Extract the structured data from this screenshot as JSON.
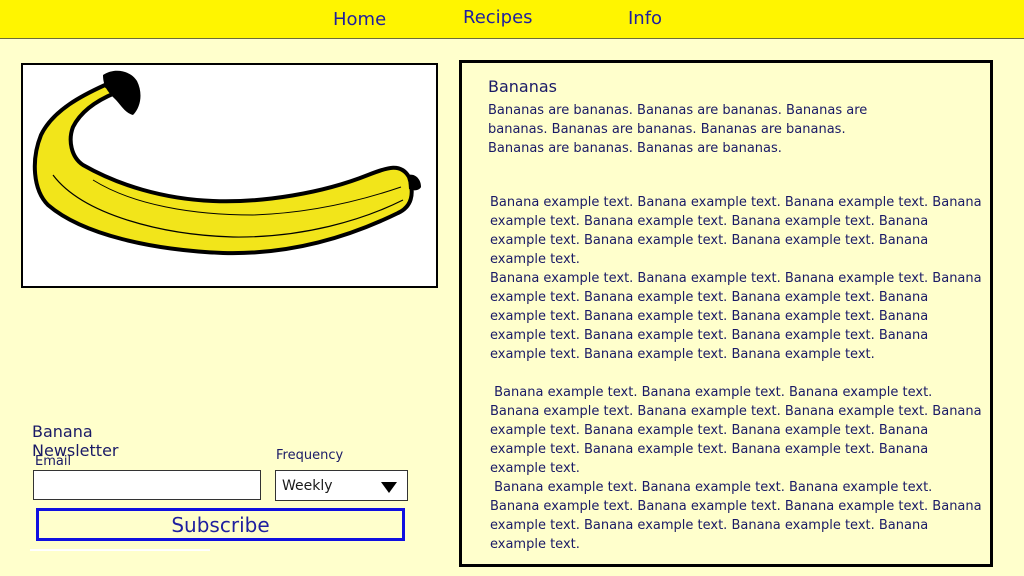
{
  "nav": {
    "items": [
      {
        "label": "Home"
      },
      {
        "label": "Recipes"
      },
      {
        "label": "Info"
      }
    ]
  },
  "hero": {
    "icon": "banana-illustration"
  },
  "article": {
    "title": "Bananas",
    "intro": "Bananas are bananas. Bananas are bananas. Bananas are bananas. Bananas are bananas. Bananas are bananas. Bananas are bananas. Bananas are bananas.",
    "paragraphs": [
      "Banana example text. Banana example text. Banana example text. Banana example text. Banana example text. Banana example text. Banana example text. Banana example text. Banana example text. Banana example text.",
      "Banana example text. Banana example text. Banana example text. Banana example text. Banana example text. Banana example text. Banana example text. Banana example text. Banana example text. Banana example text. Banana example text. Banana example text. Banana example text. Banana example text. Banana example text.",
      " Banana example text. Banana example text. Banana example text. Banana example text. Banana example text. Banana example text. Banana example text. Banana example text. Banana example text. Banana example text. Banana example text. Banana example text. Banana example text.",
      " Banana example text. Banana example text. Banana example text. Banana example text. Banana example text. Banana example text. Banana example text. Banana example text. Banana example text. Banana example text."
    ]
  },
  "newsletter": {
    "title": "Banana Newsletter",
    "email_label": "Email",
    "email_value": "",
    "frequency_label": "Frequency",
    "frequency_value": "Weekly",
    "subscribe_label": "Subscribe"
  },
  "colors": {
    "page_bg": "#ffffcc",
    "nav_bg": "#fff500",
    "link": "#1f1fa0",
    "button_border": "#1010e0",
    "banana": "#f2e51a"
  }
}
